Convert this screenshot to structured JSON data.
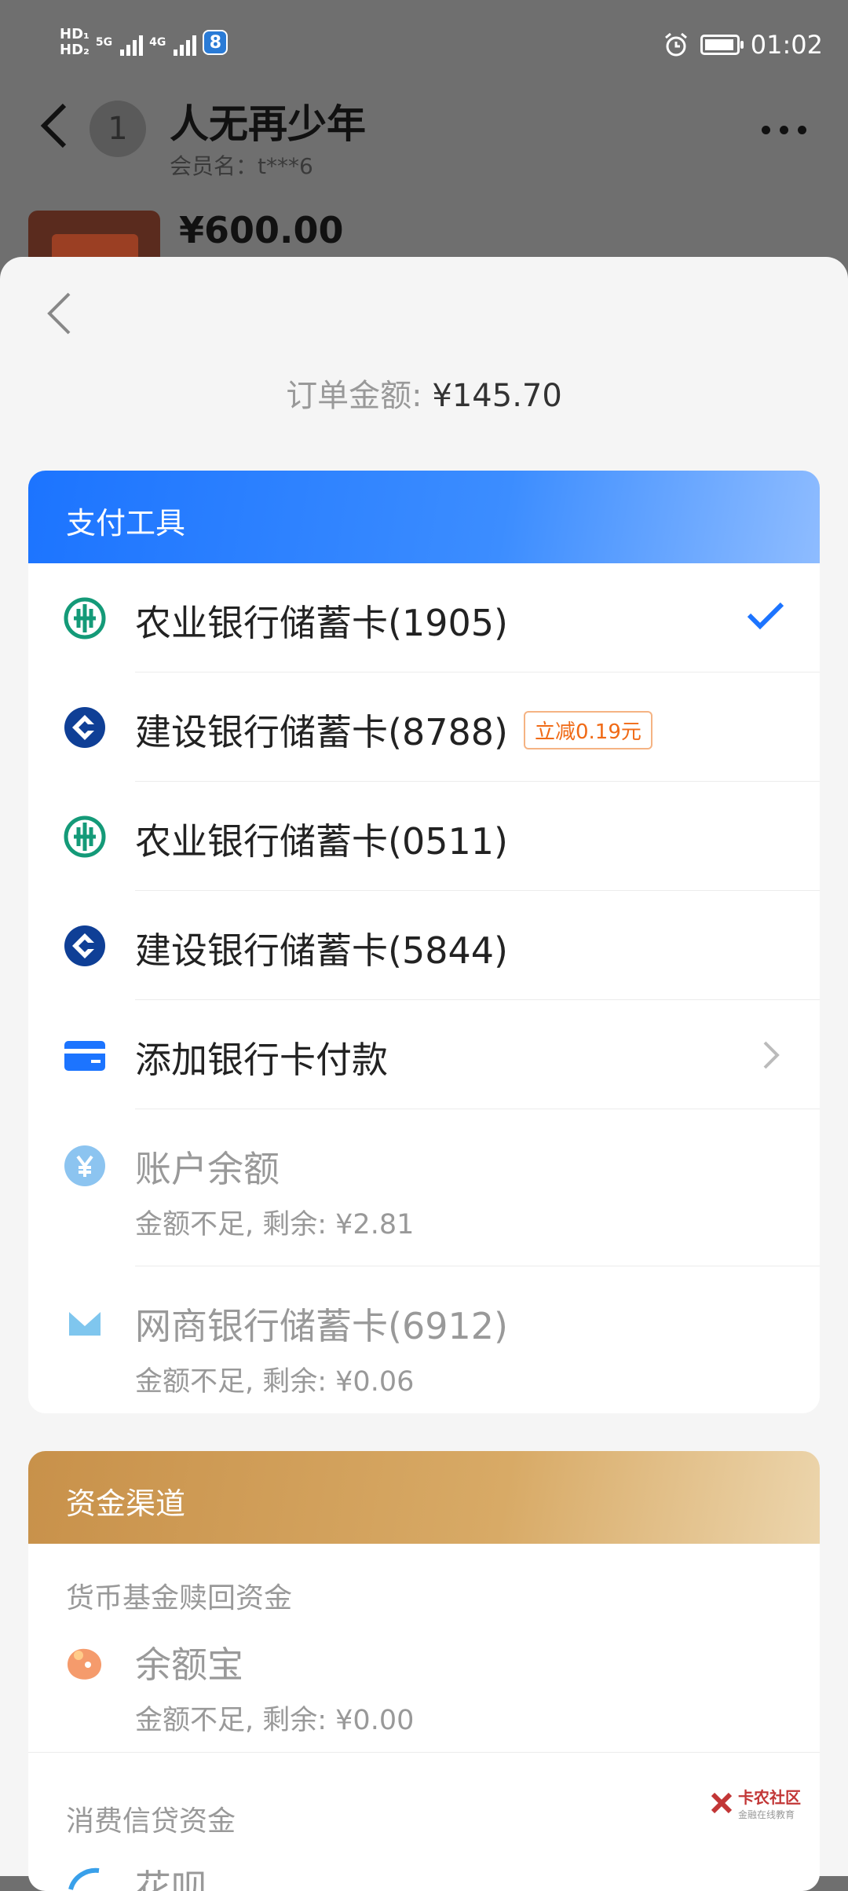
{
  "status_bar": {
    "hd1": "HD₁",
    "hd2": "HD₂",
    "net1": "5G",
    "net2": "4G",
    "app_badge": "8",
    "time": "01:02"
  },
  "chat_header": {
    "unread_count": "1",
    "title": "人无再少年",
    "member": "会员名：t***6",
    "price": "¥600.00"
  },
  "sheet": {
    "order_label": "订单金额: ",
    "order_amount": "¥145.70"
  },
  "payment": {
    "title": "支付工具",
    "items": [
      {
        "label": "农业银行储蓄卡(1905)",
        "icon": "abc-bank-icon",
        "selected": true
      },
      {
        "label": "建设银行储蓄卡(8788)",
        "icon": "ccb-bank-icon",
        "tag": "立减0.19元"
      },
      {
        "label": "农业银行储蓄卡(0511)",
        "icon": "abc-bank-icon"
      },
      {
        "label": "建设银行储蓄卡(5844)",
        "icon": "ccb-bank-icon"
      },
      {
        "label": "添加银行卡付款",
        "icon": "card-add-icon"
      },
      {
        "label": "账户余额",
        "sub": "金额不足, 剩余: ¥2.81",
        "icon": "yuan-balance-icon",
        "disabled": true
      },
      {
        "label": "网商银行储蓄卡(6912)",
        "sub": "金额不足, 剩余: ¥0.06",
        "icon": "mybank-icon",
        "disabled": true
      }
    ]
  },
  "funds": {
    "title": "资金渠道",
    "section1": "货币基金赎回资金",
    "yuebao_label": "余额宝",
    "yuebao_sub": "金额不足, 剩余: ¥0.00",
    "section2": "消费信贷资金",
    "next_label_partial": "花呗"
  },
  "watermark": {
    "main": "卡农社区",
    "sub": "金融在线教育"
  },
  "colors": {
    "accent_blue": "#1c74ff",
    "gold": "#c8914a",
    "tag_orange": "#f06a16",
    "abc_green": "#149a78",
    "ccb_blue": "#0f3f96"
  }
}
